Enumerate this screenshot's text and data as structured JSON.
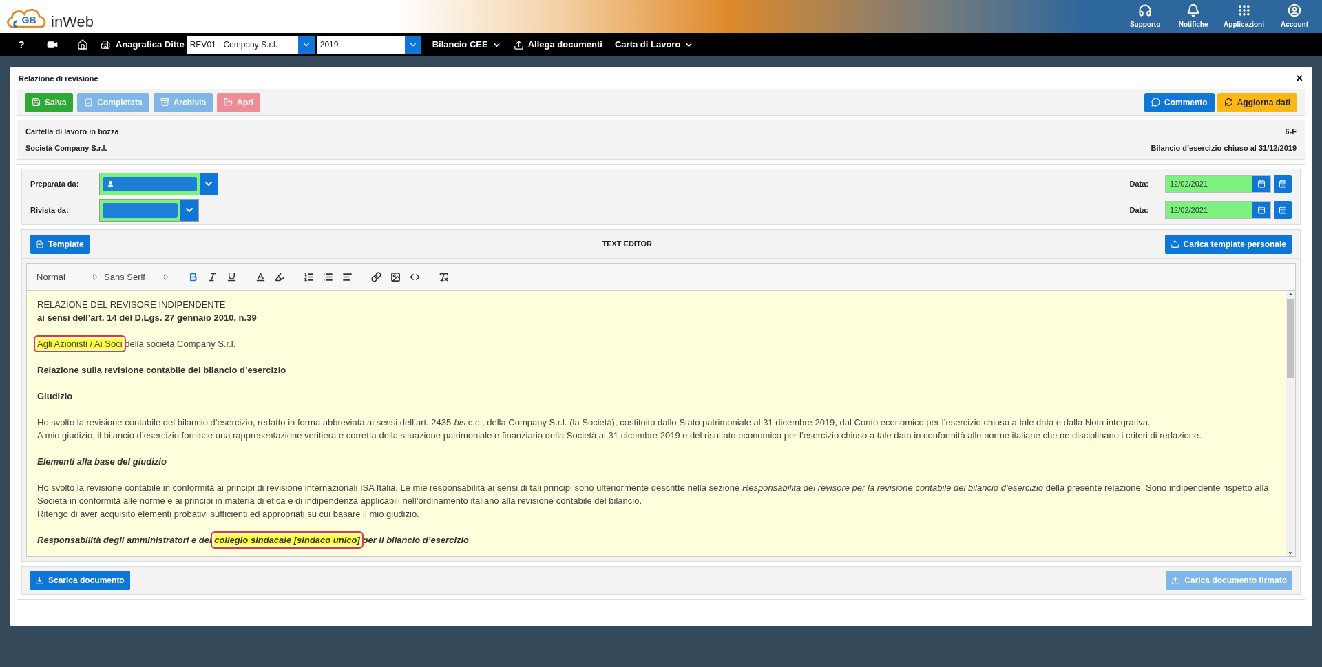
{
  "logo": {
    "mark": "GB",
    "name": "inWeb"
  },
  "header_actions": [
    {
      "kind": "support",
      "label": "Supporto"
    },
    {
      "kind": "notifications",
      "label": "Notifiche"
    },
    {
      "kind": "apps",
      "label": "Applicazioni"
    },
    {
      "kind": "account",
      "label": "Account"
    }
  ],
  "nav": {
    "help": "?",
    "company_label": "Anagrafica Ditte",
    "company_select": "REV01 - Company S.r.l.",
    "year_select": "2019",
    "menus": [
      {
        "kind": "dropdown",
        "label": "Bilancio CEE"
      },
      {
        "kind": "upload",
        "label": "Allega documenti"
      },
      {
        "kind": "dropdown",
        "label": "Carta di Lavoro"
      }
    ]
  },
  "dialog": {
    "title": "Relazione di revisione",
    "close": "×",
    "actions_left": [
      {
        "label": "Salva",
        "kind": "save",
        "disabled": false
      },
      {
        "label": "Completata",
        "kind": "complete",
        "disabled": true
      },
      {
        "label": "Archivia",
        "kind": "archive",
        "disabled": true
      },
      {
        "label": "Apri",
        "kind": "open",
        "disabled": true
      }
    ],
    "actions_right": [
      {
        "label": "Commento",
        "kind": "comment",
        "disabled": false
      },
      {
        "label": "Aggiorna dati",
        "kind": "refresh",
        "disabled": false
      }
    ],
    "info": {
      "status": "Cartella di lavoro in bozza",
      "code": "6-F",
      "company": "Società Company S.r.l.",
      "period": "Bilancio d’esercizio chiuso al 31/12/2019"
    },
    "reviewers": [
      {
        "label": "Preparata da:",
        "show_user_icon": true,
        "date_label": "Data:",
        "date": "12/02/2021"
      },
      {
        "label": "Rivista da:",
        "show_user_icon": false,
        "date_label": "Data:",
        "date": "12/02/2021"
      }
    ],
    "editor": {
      "template_button": "Template",
      "title": "TEXT EDITOR",
      "upload_template_button": "Carica template personale",
      "format_select": "Normal",
      "font_select": "Sans Serif",
      "tools": [
        {
          "kind": "bold",
          "selected": true
        },
        {
          "kind": "italic",
          "selected": false
        },
        {
          "kind": "underline",
          "selected": false
        },
        {
          "kind": "color",
          "selected": false
        },
        {
          "kind": "background",
          "selected": false
        },
        {
          "kind": "ordered-list",
          "selected": false
        },
        {
          "kind": "bullet-list",
          "selected": false
        },
        {
          "kind": "align",
          "selected": false
        },
        {
          "kind": "link",
          "selected": false
        },
        {
          "kind": "image",
          "selected": false
        },
        {
          "kind": "code",
          "selected": false
        },
        {
          "kind": "clean",
          "selected": false
        }
      ],
      "blocks": [
        {
          "kind": "heading",
          "lines": [
            "RELAZIONE DEL REVISORE INDIPENDENTE",
            "ai sensi dell’art. 14 del D.Lgs. 27 gennaio 2010, n.39"
          ]
        },
        {
          "kind": "body",
          "segments": [
            {
              "text": "Agli Azionisti / Ai Soci",
              "highlight": true,
              "annotated": true
            },
            {
              "text": " della società Company S.r.l.",
              "highlight": false,
              "annotated": false
            }
          ]
        },
        {
          "kind": "bold-underline",
          "lines": [
            "Relazione sulla revisione contabile del bilancio d’esercizio"
          ]
        },
        {
          "kind": "bold",
          "lines": [
            "Giudizio"
          ]
        },
        {
          "kind": "body",
          "lines": [
            "Ho svolto la revisione contabile del bilancio d’esercizio, redatto in forma abbreviata ai sensi dell’art. 2435-*bis* c.c., della Company S.r.l. (la Società), costituito dallo Stato patrimoniale al 31 dicembre 2019, dal Conto economico per l’esercizio chiuso a tale data e dalla Nota integrativa.",
            "A mio giudizio, il bilancio d’esercizio fornisce una rappresentazione veritiera e corretta della situazione patrimoniale e finanziaria della Società al 31 dicembre 2019 e del risultato economico per l’esercizio chiuso a tale data in conformità alle norme italiane che ne disciplinano i criteri di redazione."
          ]
        },
        {
          "kind": "bold-italic",
          "lines": [
            "Elementi alla base del giudizio"
          ]
        },
        {
          "kind": "body",
          "lines": [
            "Ho svolto la revisione contabile in conformità ai principi di revisione internazionali ISA Italia. Le mie responsabilità ai sensi di tali principi sono ulteriormente descritte nella sezione *Responsabilità del revisore per la revisione contabile del bilancio d’esercizio* della presente relazione. Sono indipendente rispetto alla Società in conformità alle norme e ai principi in materia di etica e di indipendenza applicabili nell’ordinamento italiano alla revisione contabile del bilancio.",
            "Ritengo di aver acquisito elementi probativi sufficienti ed appropriati su cui basare il mio giudizio."
          ]
        },
        {
          "kind": "bold-italic",
          "segments": [
            {
              "text": "Responsabilità degli amministratori e del ",
              "highlight": false,
              "annotated": false
            },
            {
              "text": "collegio sindacale [sindaco unico]",
              "highlight": true,
              "annotated": true
            },
            {
              "text": " per il bilancio d’esercizio",
              "highlight": false,
              "annotated": false
            }
          ]
        }
      ]
    },
    "footer": {
      "download_button": {
        "label": "Scarica documento",
        "disabled": false
      },
      "upload_signed_button": {
        "label": "Carica documento firmato",
        "disabled": true
      }
    }
  }
}
